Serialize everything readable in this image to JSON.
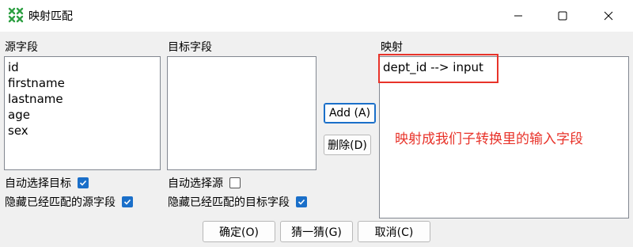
{
  "window": {
    "title": "映射匹配",
    "icons": [
      "app-icon",
      "minimize-icon",
      "maximize-icon",
      "close-icon"
    ]
  },
  "source": {
    "label": "源字段",
    "items": [
      "id",
      "firstname",
      "lastname",
      "age",
      "sex"
    ]
  },
  "target": {
    "label": "目标字段",
    "items": []
  },
  "mapping": {
    "label": "映射",
    "items": [
      "dept_id --> input"
    ]
  },
  "buttons": {
    "add": "Add (A)",
    "delete": "删除(D)",
    "ok": "确定(O)",
    "guess": "猜一猜(G)",
    "cancel": "取消(C)"
  },
  "options": {
    "auto_select_target": {
      "label": "自动选择目标",
      "checked": true
    },
    "hide_matched_source": {
      "label": "隐藏已经匹配的源字段",
      "checked": true
    },
    "auto_select_source": {
      "label": "自动选择源",
      "checked": false
    },
    "hide_matched_target": {
      "label": "隐藏已经匹配的目标字段",
      "checked": true
    }
  },
  "annotation": {
    "text": "映射成我们子转换里的输入字段",
    "color": "#e8332a"
  }
}
